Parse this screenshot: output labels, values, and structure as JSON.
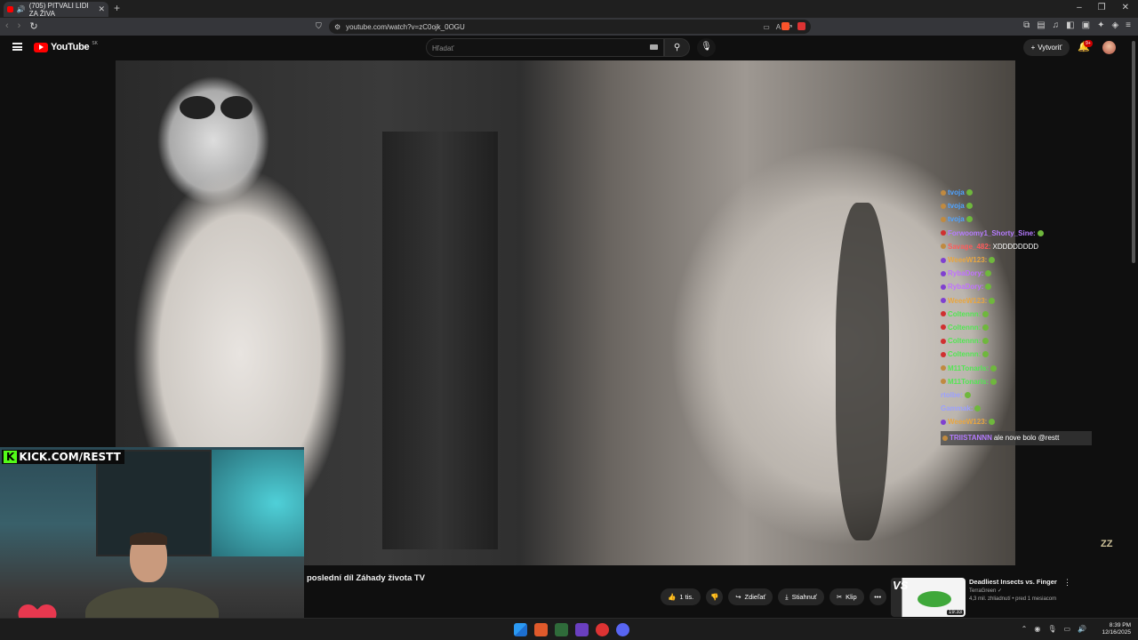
{
  "browser": {
    "tab_title": "(705) PITVALI LIDI ZA ŽIVA",
    "url": "youtube.com/watch?v=zC0ojk_0OGU"
  },
  "youtube": {
    "logo_text": "YouTube",
    "country_code": "SK",
    "search_placeholder": "Hľadať",
    "create_label": "Vytvoriť",
    "notification_count": "9+"
  },
  "video": {
    "watermark": "ZZ",
    "title": "poslední díl Záhady života TV",
    "actions": {
      "like_count": "1 tis.",
      "share_label": "Zdieľať",
      "download_label": "Stiahnuť",
      "clip_label": "Klip"
    }
  },
  "overlay": {
    "kick_banner": "KICK.COM/RESTT",
    "chat": [
      {
        "user": "tvoja",
        "msg": "",
        "color": "#4fa3ff",
        "badge": "#c08a40",
        "emote": true
      },
      {
        "user": "tvoja",
        "msg": "",
        "color": "#4fa3ff",
        "badge": "#c08a40",
        "emote": true
      },
      {
        "user": "tvoja",
        "msg": "",
        "color": "#4fa3ff",
        "badge": "#c08a40",
        "emote": true
      },
      {
        "user": "Forwoomy1_Shorty_Sine:",
        "msg": "",
        "color": "#b57bff",
        "badge": "#d03030",
        "emote": true
      },
      {
        "user": "Savage_482:",
        "msg": "XDDDDDDDD",
        "color": "#ff5a5a",
        "badge": "#c08a40",
        "emote": false
      },
      {
        "user": "WeeeW123:",
        "msg": "",
        "color": "#e8a640",
        "badge": "#8040d0",
        "emote": true
      },
      {
        "user": "RybaDory:",
        "msg": "",
        "color": "#c070ff",
        "badge": "#8040d0",
        "emote": true
      },
      {
        "user": "RybaDory:",
        "msg": "",
        "color": "#c070ff",
        "badge": "#8040d0",
        "emote": true
      },
      {
        "user": "WeeeW123:",
        "msg": "",
        "color": "#e8a640",
        "badge": "#8040d0",
        "emote": true
      },
      {
        "user": "Coltennn:",
        "msg": "",
        "color": "#53e653",
        "badge": "#d03030",
        "emote": true
      },
      {
        "user": "Coltennn:",
        "msg": "",
        "color": "#53e653",
        "badge": "#d03030",
        "emote": true
      },
      {
        "user": "Coltennn:",
        "msg": "",
        "color": "#53e653",
        "badge": "#d03030",
        "emote": true
      },
      {
        "user": "Coltennn:",
        "msg": "",
        "color": "#53e653",
        "badge": "#d03030",
        "emote": true
      },
      {
        "user": "M11TonarIs:",
        "msg": "",
        "color": "#53e653",
        "badge": "#c08a40",
        "emote": true
      },
      {
        "user": "M11TonarIs:",
        "msg": "",
        "color": "#53e653",
        "badge": "#c08a40",
        "emote": true
      },
      {
        "user": "rtolbe:",
        "msg": "",
        "color": "#9ba0ff",
        "badge": "",
        "emote": true
      },
      {
        "user": "Gammak:",
        "msg": "",
        "color": "#9ba0ff",
        "badge": "",
        "emote": true
      },
      {
        "user": "WeeeW123:",
        "msg": "",
        "color": "#e8a640",
        "badge": "#8040d0",
        "emote": true
      },
      {
        "user": "TRIISTANNN",
        "msg": "ale nove bolo @restt",
        "color": "#b57bff",
        "badge": "#c08a40",
        "emote": false,
        "pinned": true
      }
    ]
  },
  "recommended": {
    "title": "Deadliest Insects vs. Finger",
    "channel": "TerraGreen",
    "meta": "4,3 mil. zhliadnutí • pred 1 mesiacom",
    "duration": "19:33",
    "thumb_text": "VS"
  },
  "taskbar": {
    "time": "8:39 PM",
    "date": "12/16/2025"
  }
}
